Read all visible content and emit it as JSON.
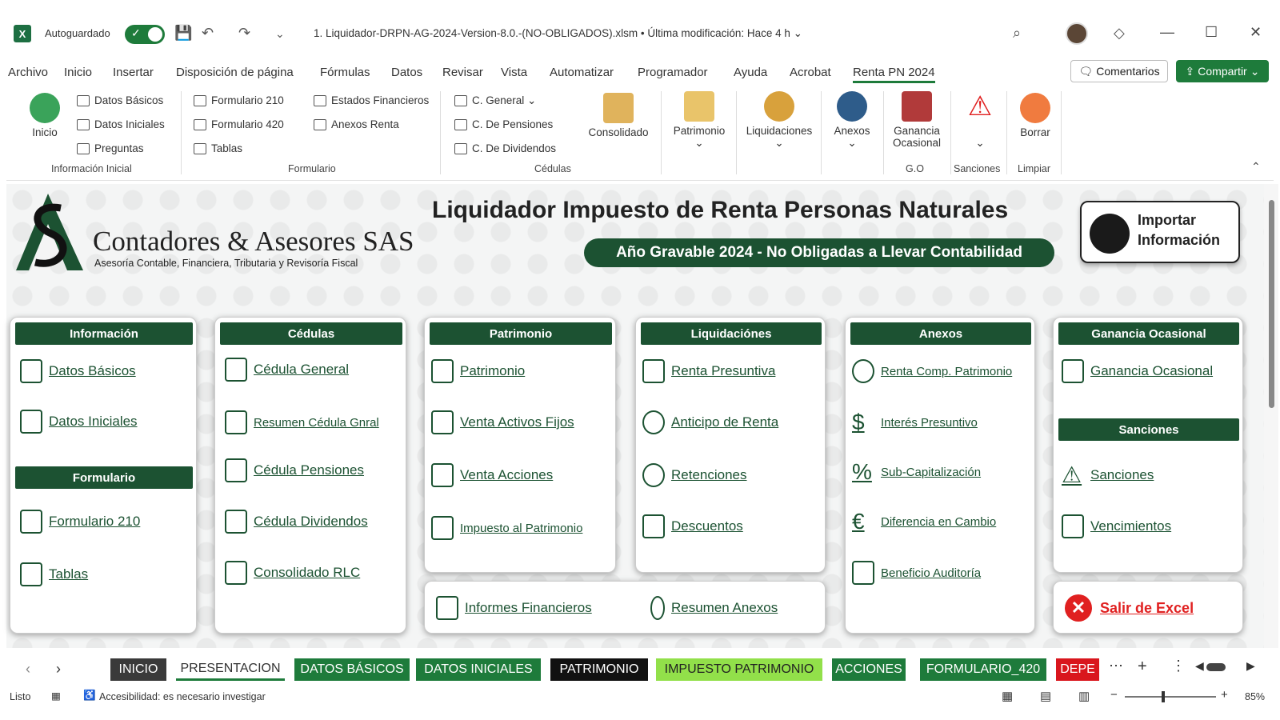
{
  "titlebar": {
    "autosave_label": "Autoguardado",
    "filename": "1. Liquidador-DRPN-AG-2024-Version-8.0.-(NO-OBLIGADOS).xlsm  •  Última modificación: Hace 4 h ⌄"
  },
  "menu": {
    "items": [
      "Archivo",
      "Inicio",
      "Insertar",
      "Disposición de página",
      "Fórmulas",
      "Datos",
      "Revisar",
      "Vista",
      "Automatizar",
      "Programador",
      "Ayuda",
      "Acrobat",
      "Renta PN 2024"
    ],
    "comments": "Comentarios",
    "share": "Compartir"
  },
  "ribbon": {
    "inicio": "Inicio",
    "datos_basicos": "Datos Básicos",
    "datos_iniciales": "Datos Iniciales",
    "preguntas": "Preguntas",
    "group_info": "Información Inicial",
    "form210": "Formulario 210",
    "form420": "Formulario 420",
    "tablas": "Tablas",
    "estados": "Estados Financieros",
    "anexos_renta": "Anexos Renta",
    "group_form": "Formulario",
    "c_general": "C. General ⌄",
    "c_pensiones": "C. De Pensiones",
    "c_dividendos": "C. De Dividendos",
    "group_cedulas": "Cédulas",
    "consolidado": "Consolidado",
    "patrimonio": "Patrimonio",
    "liquidaciones": "Liquidaciones",
    "anexos": "Anexos",
    "ganancia_1": "Ganancia",
    "ganancia_2": "Ocasional",
    "group_go": "G.O",
    "group_sanciones": "Sanciones",
    "borrar": "Borrar",
    "group_limpiar": "Limpiar"
  },
  "header": {
    "company": "Contadores & Asesores SAS",
    "company_sub": "Asesoría Contable, Financiera, Tributaria y Revisoría Fiscal",
    "title": "Liquidador Impuesto de Renta Personas Naturales",
    "subtitle": "Año Gravable 2024 - No Obligadas a Llevar Contabilidad",
    "import_1": "Importar",
    "import_2": "Información"
  },
  "cards": {
    "info": {
      "title": "Información",
      "links": [
        "Datos Básicos",
        "Datos Iniciales"
      ]
    },
    "formulario": {
      "title": "Formulario",
      "links": [
        "Formulario 210",
        "Tablas"
      ]
    },
    "cedulas": {
      "title": "Cédulas",
      "links": [
        "Cédula General",
        "Resumen Cédula Gnral",
        "Cédula Pensiones",
        "Cédula Dividendos",
        "Consolidado RLC"
      ]
    },
    "patrimonio": {
      "title": "Patrimonio",
      "links": [
        "Patrimonio",
        "Venta Activos Fijos",
        "Venta Acciones",
        "Impuesto al Patrimonio"
      ]
    },
    "liquidaciones": {
      "title": "Liquidaciónes",
      "links": [
        "Renta Presuntiva",
        "Anticipo de Renta",
        "Retenciones",
        "Descuentos"
      ]
    },
    "anexos": {
      "title": "Anexos",
      "links": [
        "Renta Comp. Patrimonio",
        "Interés Presuntivo",
        "Sub-Capitalización",
        "Diferencia en Cambio",
        "Beneficio Auditoría"
      ]
    },
    "ganancia": {
      "title": "Ganancia Ocasional",
      "links": [
        "Ganancia Ocasional"
      ]
    },
    "sanciones": {
      "title": "Sanciones",
      "links": [
        "Sanciones",
        "Vencimientos"
      ]
    },
    "bottom": {
      "links": [
        "Informes Financieros",
        "Resumen Anexos"
      ]
    },
    "exit": "Salir de Excel"
  },
  "tabs": [
    {
      "label": "INICIO",
      "bg": "#3a3a3a"
    },
    {
      "label": "PRESENTACION",
      "bg": "#ffffff"
    },
    {
      "label": "DATOS BÁSICOS",
      "bg": "#1e7b3b"
    },
    {
      "label": "DATOS INICIALES",
      "bg": "#1e7b3b"
    },
    {
      "label": "PATRIMONIO",
      "bg": "#111111"
    },
    {
      "label": "IMPUESTO PATRIMONIO",
      "bg": "#92e04a"
    },
    {
      "label": "ACCIONES",
      "bg": "#1e7b3b"
    },
    {
      "label": "FORMULARIO_420",
      "bg": "#1e7b3b"
    },
    {
      "label": "DEPE",
      "bg": "#d9161d"
    }
  ],
  "status": {
    "ready": "Listo",
    "accessibility": "Accesibilidad: es necesario investigar",
    "zoom": "85%"
  }
}
